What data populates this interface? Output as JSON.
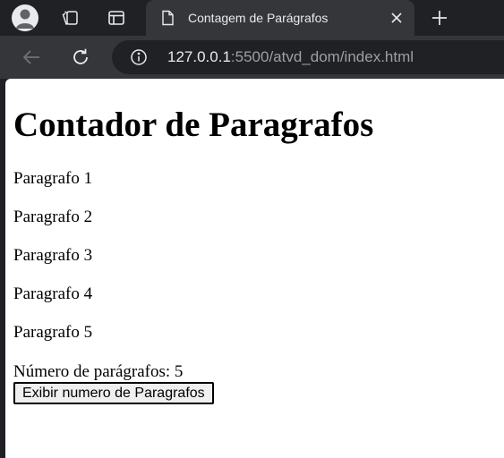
{
  "browser": {
    "tab_title": "Contagem de Parágrafos",
    "url_host": "127.0.0.1",
    "url_rest": ":5500/atvd_dom/index.html",
    "icons": [
      "profile-icon",
      "workspaces-icon",
      "tab-actions-icon",
      "page-icon",
      "close-icon",
      "new-tab-icon",
      "back-icon",
      "reload-icon",
      "site-info-icon"
    ]
  },
  "page": {
    "heading": "Contador de Paragrafos",
    "paragraphs": [
      "Paragrafo 1",
      "Paragrafo 2",
      "Paragrafo 3",
      "Paragrafo 4",
      "Paragrafo 5"
    ],
    "count_text": "Número de parágrafos: 5",
    "button_label": "Exibir numero de Paragrafos"
  }
}
